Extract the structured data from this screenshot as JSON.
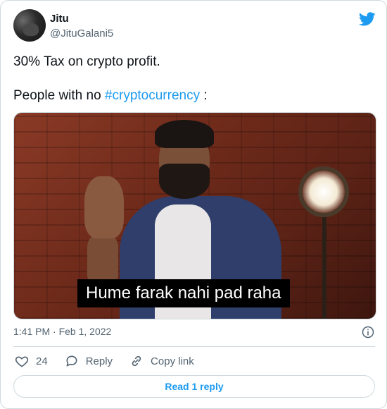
{
  "author": {
    "name": "Jitu",
    "handle": "@JituGalani5"
  },
  "tweet": {
    "line1": "30% Tax on crypto profit.",
    "line2_prefix": "People with no ",
    "hashtag": "#cryptocurrency",
    "line2_suffix": " :"
  },
  "media": {
    "caption": "Hume farak nahi pad raha"
  },
  "meta": {
    "timestamp": "1:41 PM · Feb 1, 2022"
  },
  "actions": {
    "like_count": "24",
    "reply_label": "Reply",
    "copy_label": "Copy link"
  },
  "read_replies": "Read 1 reply",
  "colors": {
    "accent": "#1d9bf0",
    "text": "#0f1419",
    "muted": "#536471",
    "border": "#cfd9de"
  },
  "icons": {
    "brand": "twitter-bird-icon",
    "info": "info-icon",
    "like": "heart-icon",
    "reply": "reply-bubble-icon",
    "copy": "link-icon"
  }
}
